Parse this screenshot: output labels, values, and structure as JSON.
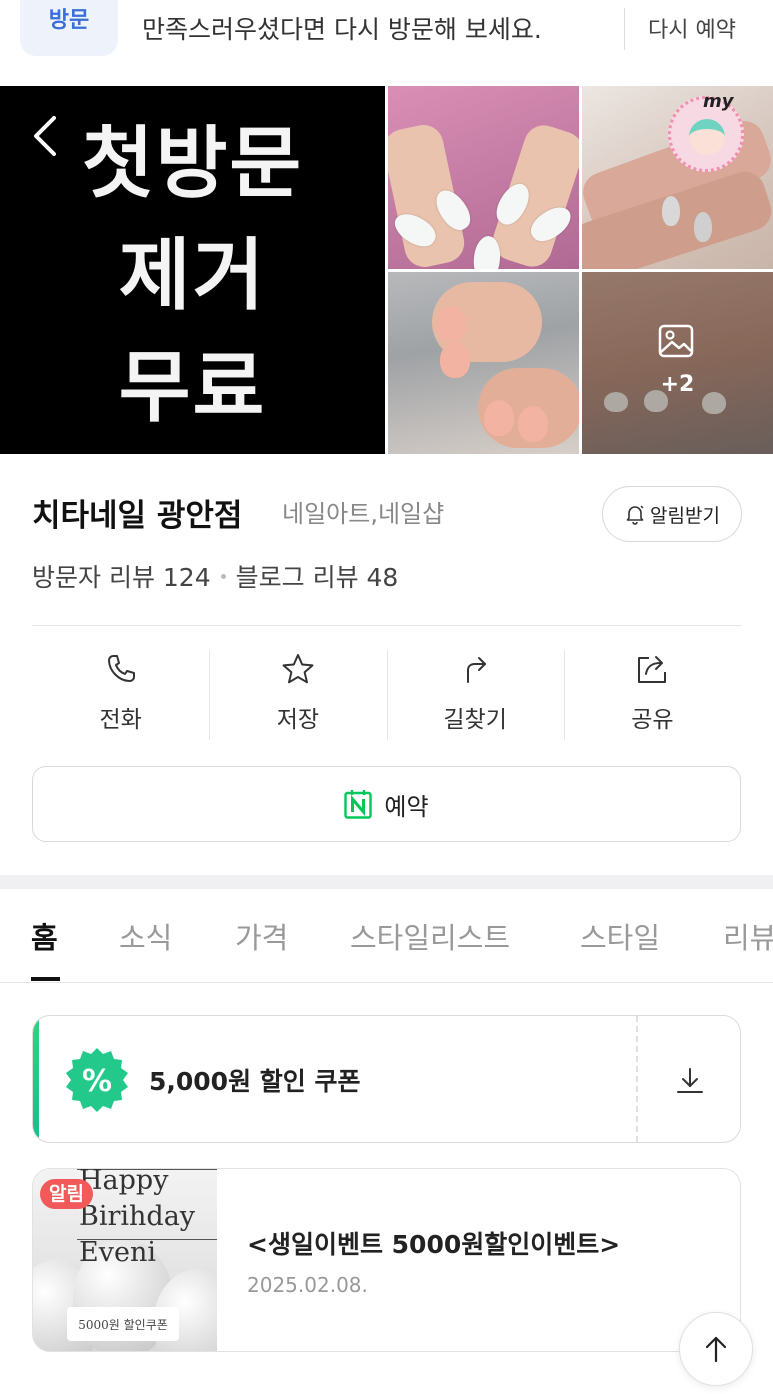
{
  "visit_banner": {
    "chip_label": "방문",
    "message": "만족스러우셨다면 다시 방문해 보세요.",
    "revisit_label": "다시 예약"
  },
  "gallery": {
    "promo_lines": [
      "첫방문",
      "제거",
      "무료"
    ],
    "more_count": "+2",
    "badge_text": "my"
  },
  "place": {
    "name": "치타네일 광안점",
    "category": "네일아트,네일샵",
    "notify_label": "알림받기",
    "visitor_reviews": "방문자 리뷰 124",
    "blog_reviews": "블로그 리뷰 48"
  },
  "actions": [
    {
      "label": "전화",
      "icon": "phone-icon"
    },
    {
      "label": "저장",
      "icon": "star-icon"
    },
    {
      "label": "길찾기",
      "icon": "directions-icon"
    },
    {
      "label": "공유",
      "icon": "share-icon"
    }
  ],
  "reserve": {
    "label": "예약",
    "icon": "naver-booking-icon"
  },
  "tabs": [
    {
      "label": "홈",
      "active": true
    },
    {
      "label": "소식",
      "active": false
    },
    {
      "label": "가격",
      "active": false
    },
    {
      "label": "스타일리스트",
      "active": false
    },
    {
      "label": "스타일",
      "active": false
    },
    {
      "label": "리뷰",
      "active": false
    }
  ],
  "coupon": {
    "text": "5,000원 할인 쿠폰",
    "badge_symbol": "%",
    "accent_color": "#22c98a"
  },
  "news": {
    "badge": "알림",
    "title": "<생일이벤트 5000원할인이벤트>",
    "date": "2025.02.08.",
    "thumb_lines": [
      "Happy",
      "Birihday",
      "Eveni"
    ],
    "thumb_coupon": "5000원 할인쿠폰"
  },
  "colors": {
    "alert_red": "#f25a5a",
    "naver_green": "#03c75a",
    "visit_blue": "#3a6fd8"
  }
}
